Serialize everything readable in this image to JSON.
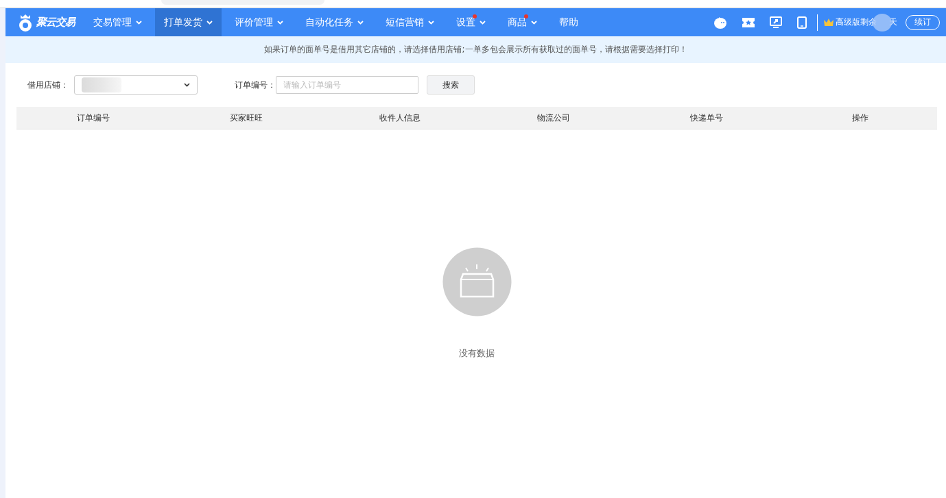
{
  "logo": {
    "text": "聚云交易"
  },
  "nav": [
    {
      "label": "交易管理",
      "selected": false,
      "dropdown": true,
      "dot": false
    },
    {
      "label": "打单发货",
      "selected": true,
      "dropdown": true,
      "dot": false
    },
    {
      "label": "评价管理",
      "selected": false,
      "dropdown": true,
      "dot": false
    },
    {
      "label": "自动化任务",
      "selected": false,
      "dropdown": true,
      "dot": false
    },
    {
      "label": "短信营销",
      "selected": false,
      "dropdown": true,
      "dot": false
    },
    {
      "label": "设置",
      "selected": false,
      "dropdown": true,
      "dot": true
    },
    {
      "label": "商品",
      "selected": false,
      "dropdown": true,
      "dot": true
    },
    {
      "label": "帮助",
      "selected": false,
      "dropdown": false,
      "dot": false
    }
  ],
  "version": {
    "label": "高级版剩余",
    "suffix": "天",
    "renew": "续订"
  },
  "notice": "如果订单的面单号是借用其它店铺的，请选择借用店铺;一单多包会展示所有获取过的面单号，请根据需要选择打印！",
  "filters": {
    "shop_label": "借用店铺：",
    "order_label": "订单编号：",
    "order_placeholder": "请输入订单编号",
    "search": "搜索"
  },
  "table": {
    "columns": [
      "订单编号",
      "买家旺旺",
      "收件人信息",
      "物流公司",
      "快递单号",
      "操作"
    ]
  },
  "empty": "没有数据"
}
